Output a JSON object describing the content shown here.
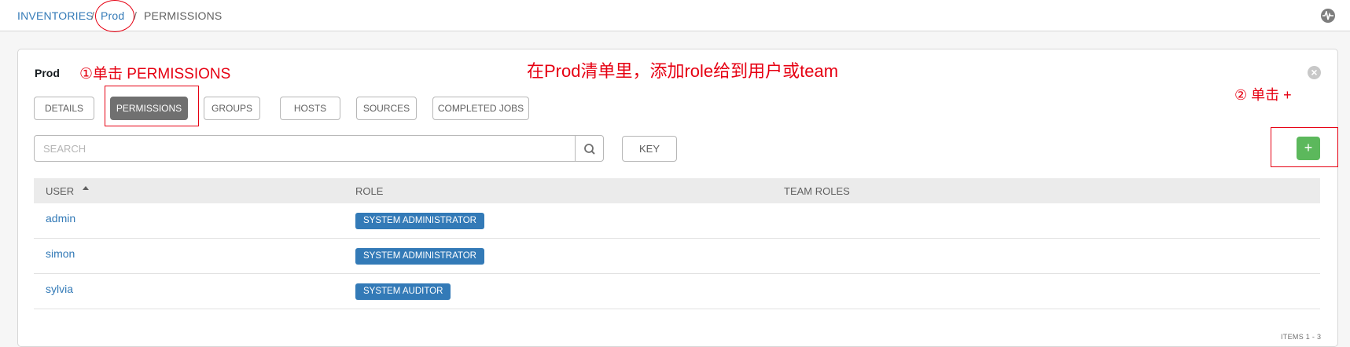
{
  "breadcrumb": {
    "inventories": "INVENTORIES",
    "sep1": "/",
    "prod": "Prod",
    "sep2": "/",
    "current": "PERMISSIONS"
  },
  "panel": {
    "title": "Prod",
    "tabs": [
      {
        "label": "DETAILS",
        "active": false
      },
      {
        "label": "PERMISSIONS",
        "active": true
      },
      {
        "label": "GROUPS",
        "active": false
      },
      {
        "label": "HOSTS",
        "active": false
      },
      {
        "label": "SOURCES",
        "active": false
      },
      {
        "label": "COMPLETED JOBS",
        "active": false
      }
    ],
    "search": {
      "placeholder": "SEARCH",
      "value": ""
    },
    "key_label": "KEY",
    "add_label": "+",
    "icons": {
      "close": "close-icon",
      "search": "search-icon",
      "sort": "sort-asc-icon",
      "activity": "activity-stream-icon"
    }
  },
  "table": {
    "headers": {
      "user": "USER",
      "role": "ROLE",
      "team_roles": "TEAM ROLES"
    },
    "rows": [
      {
        "user": "admin",
        "role": "SYSTEM ADMINISTRATOR"
      },
      {
        "user": "simon",
        "role": "SYSTEM ADMINISTRATOR"
      },
      {
        "user": "sylvia",
        "role": "SYSTEM AUDITOR"
      }
    ],
    "items_count": "ITEMS  1 - 3"
  },
  "annotations": {
    "step1": "①单击 PERMISSIONS",
    "step2": "② 单击 +",
    "headline": "在Prod清单里，添加role给到用户或team",
    "color": "#e60012"
  },
  "colors": {
    "link": "#337ab7",
    "badge": "#337ab7",
    "add": "#5cb85c",
    "active_tab": "#707070"
  }
}
